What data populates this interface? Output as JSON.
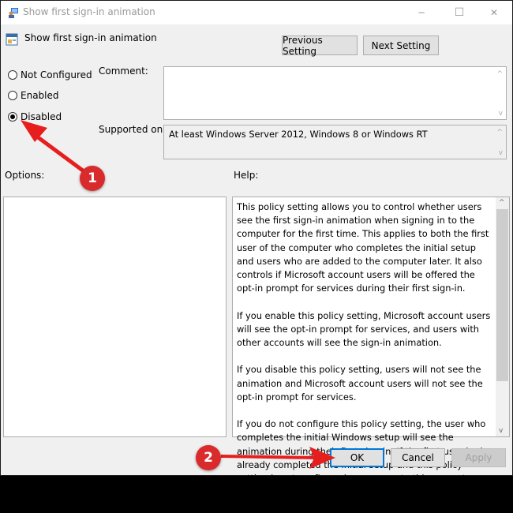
{
  "window": {
    "title": "Show first sign-in animation",
    "controls": {
      "minimize": "─",
      "maximize": "☐",
      "close": "✕"
    }
  },
  "header": {
    "policy_name": "Show first sign-in animation",
    "previous_button": "Previous Setting",
    "next_button": "Next Setting"
  },
  "state_options": [
    {
      "label": "Not Configured",
      "selected": false
    },
    {
      "label": "Enabled",
      "selected": false
    },
    {
      "label": "Disabled",
      "selected": true
    }
  ],
  "comment": {
    "label": "Comment:",
    "value": ""
  },
  "supported_on": {
    "label": "Supported on:",
    "value": "At least Windows Server 2012, Windows 8 or Windows RT"
  },
  "options": {
    "label": "Options:"
  },
  "help": {
    "label": "Help:",
    "paragraphs": [
      "This policy setting allows you to control whether users see the first sign-in animation when signing in to the computer for the first time.  This applies to both the first user of the computer who completes the initial setup and users who are added to the computer later.  It also controls if Microsoft account users will be offered the opt-in prompt for services during their first sign-in.",
      "If you enable this policy setting, Microsoft account users will see the opt-in prompt for services, and users with other accounts will see the sign-in animation.",
      "If you disable this policy setting, users will not see the animation and Microsoft account users will not see the opt-in prompt for services.",
      "If you do not configure this policy setting, the user who completes the initial Windows setup will see the animation during their first sign-in. If the first user had already completed the initial setup and this policy setting is not configured, users new to this computer will not see the animation."
    ]
  },
  "footer": {
    "ok": "OK",
    "cancel": "Cancel",
    "apply": "Apply"
  },
  "annotations": [
    {
      "number": "1",
      "target": "Disabled radio"
    },
    {
      "number": "2",
      "target": "OK button"
    }
  ],
  "colors": {
    "annotation_red": "#d92b2b",
    "focus_blue": "#0078d7"
  }
}
